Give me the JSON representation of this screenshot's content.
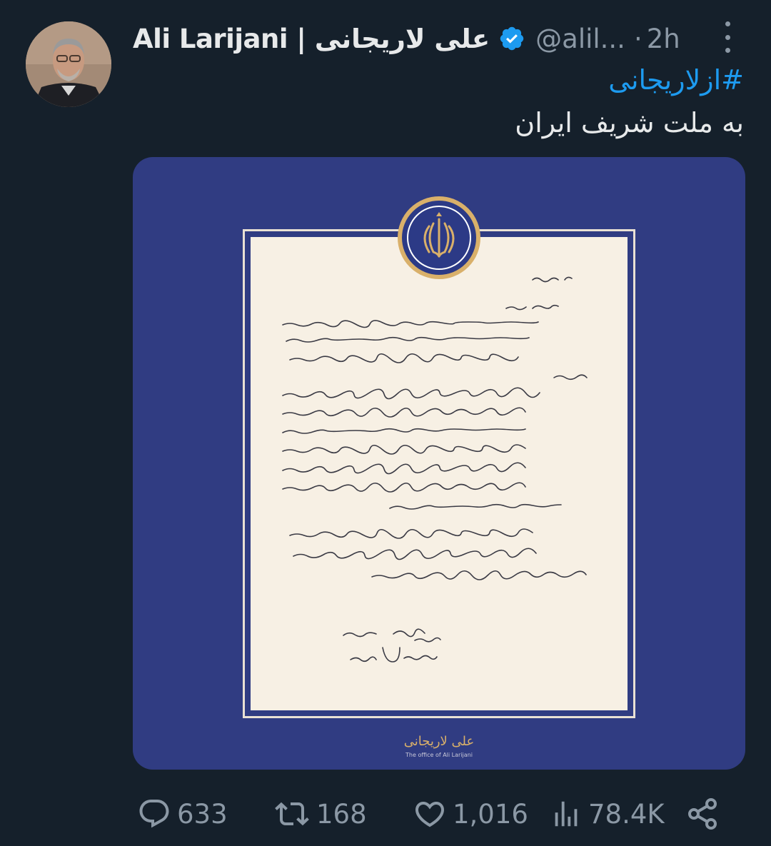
{
  "author": {
    "name": "Ali Larijani | علی لاریجانی",
    "handle": "@alil...",
    "dot": "·",
    "time": "2h",
    "verified_color": "#1d9bf0"
  },
  "tweet": {
    "hashtag": "#ازلاریجانی",
    "text": "به ملت شریف ایران"
  },
  "media": {
    "background_color": "#303c82",
    "logo_text": "علی لاریجانی",
    "logo_caption": "The office of Ali Larijani"
  },
  "actions": {
    "replies": "633",
    "retweets": "168",
    "likes": "1,016",
    "views": "78.4K"
  },
  "icons": {
    "more": "more-vertical-icon",
    "verified": "verified-badge-icon",
    "reply": "reply-icon",
    "retweet": "retweet-icon",
    "like": "heart-icon",
    "views": "views-chart-icon",
    "share": "share-icon"
  }
}
